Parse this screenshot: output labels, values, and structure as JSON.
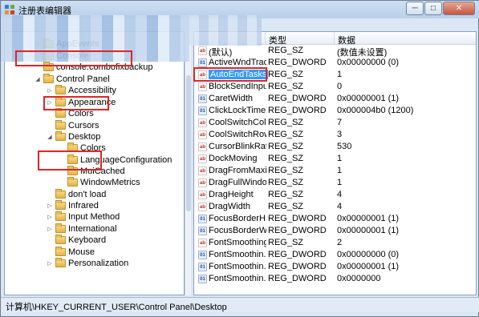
{
  "window": {
    "title": "注册表编辑器",
    "controls": {
      "minimize": "─",
      "maximize": "□",
      "close": "✕"
    }
  },
  "tree": {
    "items": [
      {
        "label": "AppEvents",
        "expander": "▷",
        "indent": 0
      },
      {
        "label": "Console",
        "expander": "",
        "indent": 0
      },
      {
        "label": "console.combofixbackup",
        "expander": "",
        "indent": 0
      },
      {
        "label": "Control Panel",
        "expander": "◢",
        "indent": 0
      },
      {
        "label": "Accessibility",
        "expander": "▷",
        "indent": 1
      },
      {
        "label": "Appearance",
        "expander": "▷",
        "indent": 1
      },
      {
        "label": "Colors",
        "expander": "",
        "indent": 1
      },
      {
        "label": "Cursors",
        "expander": "",
        "indent": 1
      },
      {
        "label": "Desktop",
        "expander": "◢",
        "indent": 1
      },
      {
        "label": "Colors",
        "expander": "",
        "indent": 2
      },
      {
        "label": "LanguageConfiguration",
        "expander": "",
        "indent": 2
      },
      {
        "label": "MuiCached",
        "expander": "",
        "indent": 2
      },
      {
        "label": "WindowMetrics",
        "expander": "",
        "indent": 2
      },
      {
        "label": "don't load",
        "expander": "",
        "indent": 1
      },
      {
        "label": "Infrared",
        "expander": "▷",
        "indent": 1
      },
      {
        "label": "Input Method",
        "expander": "▷",
        "indent": 1
      },
      {
        "label": "International",
        "expander": "▷",
        "indent": 1
      },
      {
        "label": "Keyboard",
        "expander": "",
        "indent": 1
      },
      {
        "label": "Mouse",
        "expander": "",
        "indent": 1
      },
      {
        "label": "Personalization",
        "expander": "▷",
        "indent": 1
      }
    ]
  },
  "list": {
    "columns": {
      "name": "",
      "type": "类型",
      "data": "数据"
    },
    "rows": [
      {
        "name": "(默认)",
        "type": "REG_SZ",
        "data": "(数值未设置)",
        "icon": "ab",
        "kind": "sz"
      },
      {
        "name": "ActiveWndTrac...",
        "type": "REG_DWORD",
        "data": "0x00000000 (0)",
        "icon": "01",
        "kind": "dw"
      },
      {
        "name": "AutoEndTasks",
        "type": "REG_SZ",
        "data": "1",
        "icon": "ab",
        "kind": "sz",
        "highlight": true
      },
      {
        "name": "BlockSendInpu...",
        "type": "REG_SZ",
        "data": "0",
        "icon": "ab",
        "kind": "sz"
      },
      {
        "name": "CaretWidth",
        "type": "REG_DWORD",
        "data": "0x00000001 (1)",
        "icon": "01",
        "kind": "dw"
      },
      {
        "name": "ClickLockTime",
        "type": "REG_DWORD",
        "data": "0x000004b0 (1200)",
        "icon": "01",
        "kind": "dw"
      },
      {
        "name": "CoolSwitchCol...",
        "type": "REG_SZ",
        "data": "7",
        "icon": "ab",
        "kind": "sz"
      },
      {
        "name": "CoolSwitchRows",
        "type": "REG_SZ",
        "data": "3",
        "icon": "ab",
        "kind": "sz"
      },
      {
        "name": "CursorBlinkRate",
        "type": "REG_SZ",
        "data": "530",
        "icon": "ab",
        "kind": "sz"
      },
      {
        "name": "DockMoving",
        "type": "REG_SZ",
        "data": "1",
        "icon": "ab",
        "kind": "sz"
      },
      {
        "name": "DragFromMaxi...",
        "type": "REG_SZ",
        "data": "1",
        "icon": "ab",
        "kind": "sz"
      },
      {
        "name": "DragFullWindo...",
        "type": "REG_SZ",
        "data": "1",
        "icon": "ab",
        "kind": "sz"
      },
      {
        "name": "DragHeight",
        "type": "REG_SZ",
        "data": "4",
        "icon": "ab",
        "kind": "sz"
      },
      {
        "name": "DragWidth",
        "type": "REG_SZ",
        "data": "4",
        "icon": "ab",
        "kind": "sz"
      },
      {
        "name": "FocusBorderH...",
        "type": "REG_DWORD",
        "data": "0x00000001 (1)",
        "icon": "01",
        "kind": "dw"
      },
      {
        "name": "FocusBorderW...",
        "type": "REG_DWORD",
        "data": "0x00000001 (1)",
        "icon": "01",
        "kind": "dw"
      },
      {
        "name": "FontSmoothing",
        "type": "REG_SZ",
        "data": "2",
        "icon": "ab",
        "kind": "sz"
      },
      {
        "name": "FontSmoothin...",
        "type": "REG_DWORD",
        "data": "0x00000000 (0)",
        "icon": "01",
        "kind": "dw"
      },
      {
        "name": "FontSmoothin...",
        "type": "REG_DWORD",
        "data": "0x00000001 (1)",
        "icon": "01",
        "kind": "dw"
      },
      {
        "name": "FontSmoothin...",
        "type": "REG_DWORD",
        "data": "0x0000000",
        "icon": "01",
        "kind": "dw"
      }
    ]
  },
  "status": {
    "path": "计算机\\HKEY_CURRENT_USER\\Control Panel\\Desktop"
  },
  "colors": {
    "annotation_red": "#e32424",
    "selection_blue": "#3399ff"
  }
}
